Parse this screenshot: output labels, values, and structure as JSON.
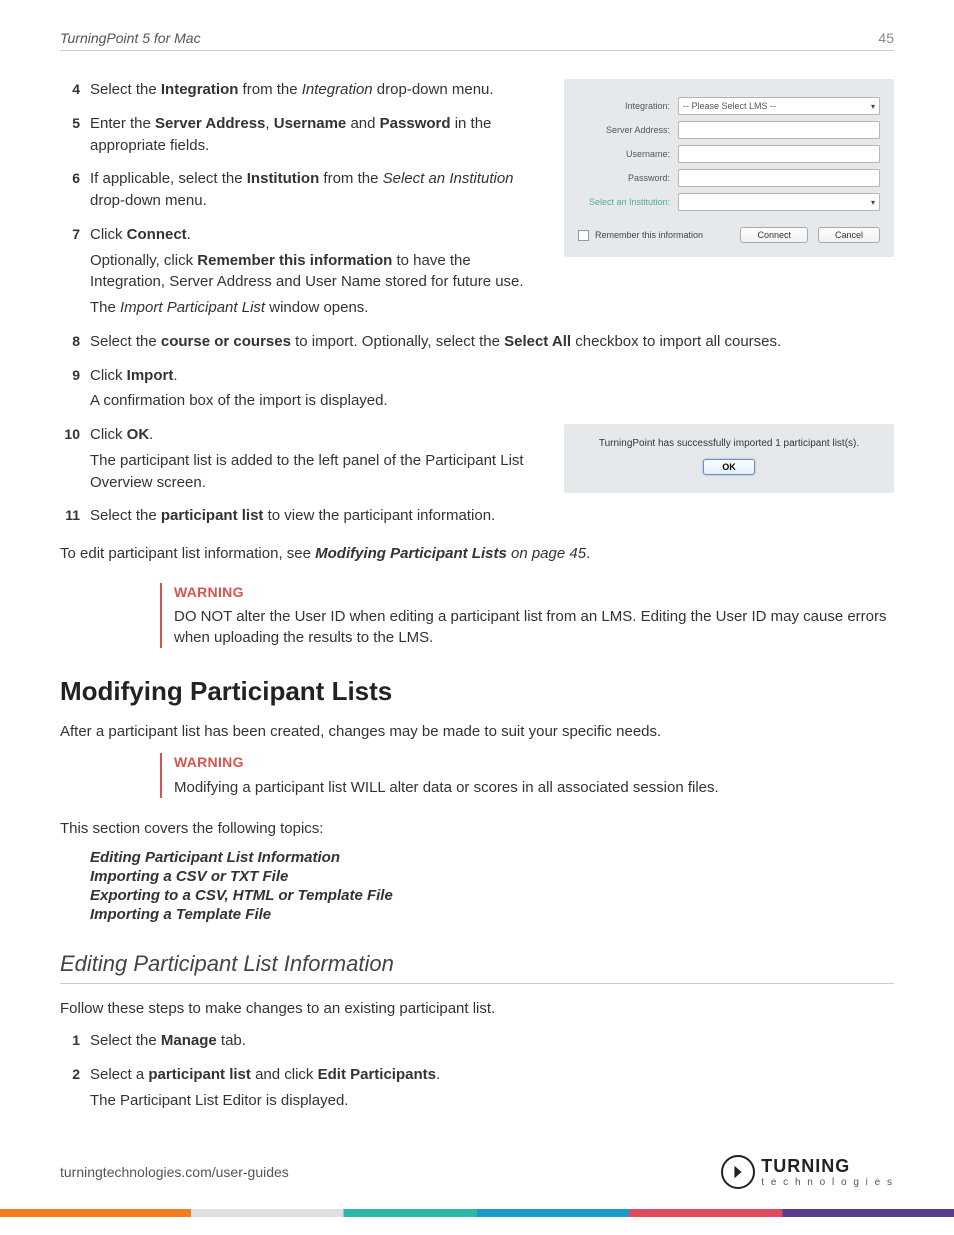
{
  "header": {
    "title": "TurningPoint 5 for Mac",
    "page": "45"
  },
  "steps_a": [
    {
      "n": "4",
      "parts": [
        [
          "Select the ",
          "",
          "Integration",
          " from the ",
          ""
        ],
        [
          "",
          "italic",
          "Integration",
          ""
        ],
        [
          " drop-down menu.",
          "",
          "",
          ""
        ]
      ],
      "html": "Select the <b>Integration</b> from the <i>Integration</i> drop-down menu."
    },
    {
      "n": "5",
      "html": "Enter the <b>Server Address</b>, <b>Username</b> and <b>Password</b> in the appropriate fields."
    },
    {
      "n": "6",
      "html": "If applicable, select the <b>Institution</b> from the <i>Select an Institution</i> drop-down menu."
    },
    {
      "n": "7",
      "html": "Click <b>Connect</b>.",
      "sub": [
        "Optionally, click <b>Remember this information</b> to have the Integration, Server Address and User Name stored for future use.",
        "The <i>Import Participant List</i> window opens."
      ]
    }
  ],
  "steps_b": [
    {
      "n": "8",
      "html": "Select the <b>course or courses</b> to import. Optionally, select the <b>Select All</b> checkbox to import all courses."
    },
    {
      "n": "9",
      "html": "Click <b>Import</b>.",
      "sub": [
        "A confirmation box of the import is displayed."
      ]
    }
  ],
  "steps_c": [
    {
      "n": "10",
      "html": "Click <b>OK</b>.",
      "sub": [
        "The participant list is added to the left panel of the Participant List Overview screen."
      ]
    }
  ],
  "steps_d": [
    {
      "n": "11",
      "html": "Select the <b>participant list</b> to view the participant information."
    }
  ],
  "edit_para": "To edit participant list information, see <b><i>Modifying Participant Lists</i></b>  <i>on page 45</i>.",
  "warning1": {
    "label": "WARNING",
    "text": "DO NOT alter the User ID when editing a participant list from an LMS. Editing the User ID may cause errors when uploading the results to the LMS."
  },
  "section_title": "Modifying Participant Lists",
  "section_intro": "After a participant list has been created, changes may be made to suit your specific needs.",
  "warning2": {
    "label": "WARNING",
    "text": "Modifying a participant list WILL alter data or scores in all associated session files."
  },
  "topics_intro": "This section covers the following topics:",
  "topics": [
    "Editing Participant List Information",
    "Importing a CSV or TXT File",
    "Exporting to a CSV, HTML or Template File",
    "Importing a Template File"
  ],
  "subsection_title": "Editing Participant List Information",
  "subsection_intro": "Follow these steps to make changes to an existing participant list.",
  "steps_e": [
    {
      "n": "1",
      "html": "Select the <b>Manage</b> tab."
    },
    {
      "n": "2",
      "html": "Select a <b>participant list</b> and click <b>Edit Participants</b>.",
      "sub": [
        "The Participant List Editor is displayed."
      ]
    }
  ],
  "footer_url": "turningtechnologies.com/user-guides",
  "logo": {
    "big": "TURNING",
    "small": "t e c h n o l o g i e s"
  },
  "fig_dialog": {
    "labels": {
      "integration": "Integration:",
      "server": "Server Address:",
      "user": "Username:",
      "pass": "Password:",
      "inst": "Select an Institution:"
    },
    "placeholder": "-- Please Select LMS --",
    "remember": "Remember this information",
    "connect": "Connect",
    "cancel": "Cancel"
  },
  "fig_confirm": {
    "msg": "TurningPoint has successfully imported 1 participant list(s).",
    "ok": "OK"
  }
}
